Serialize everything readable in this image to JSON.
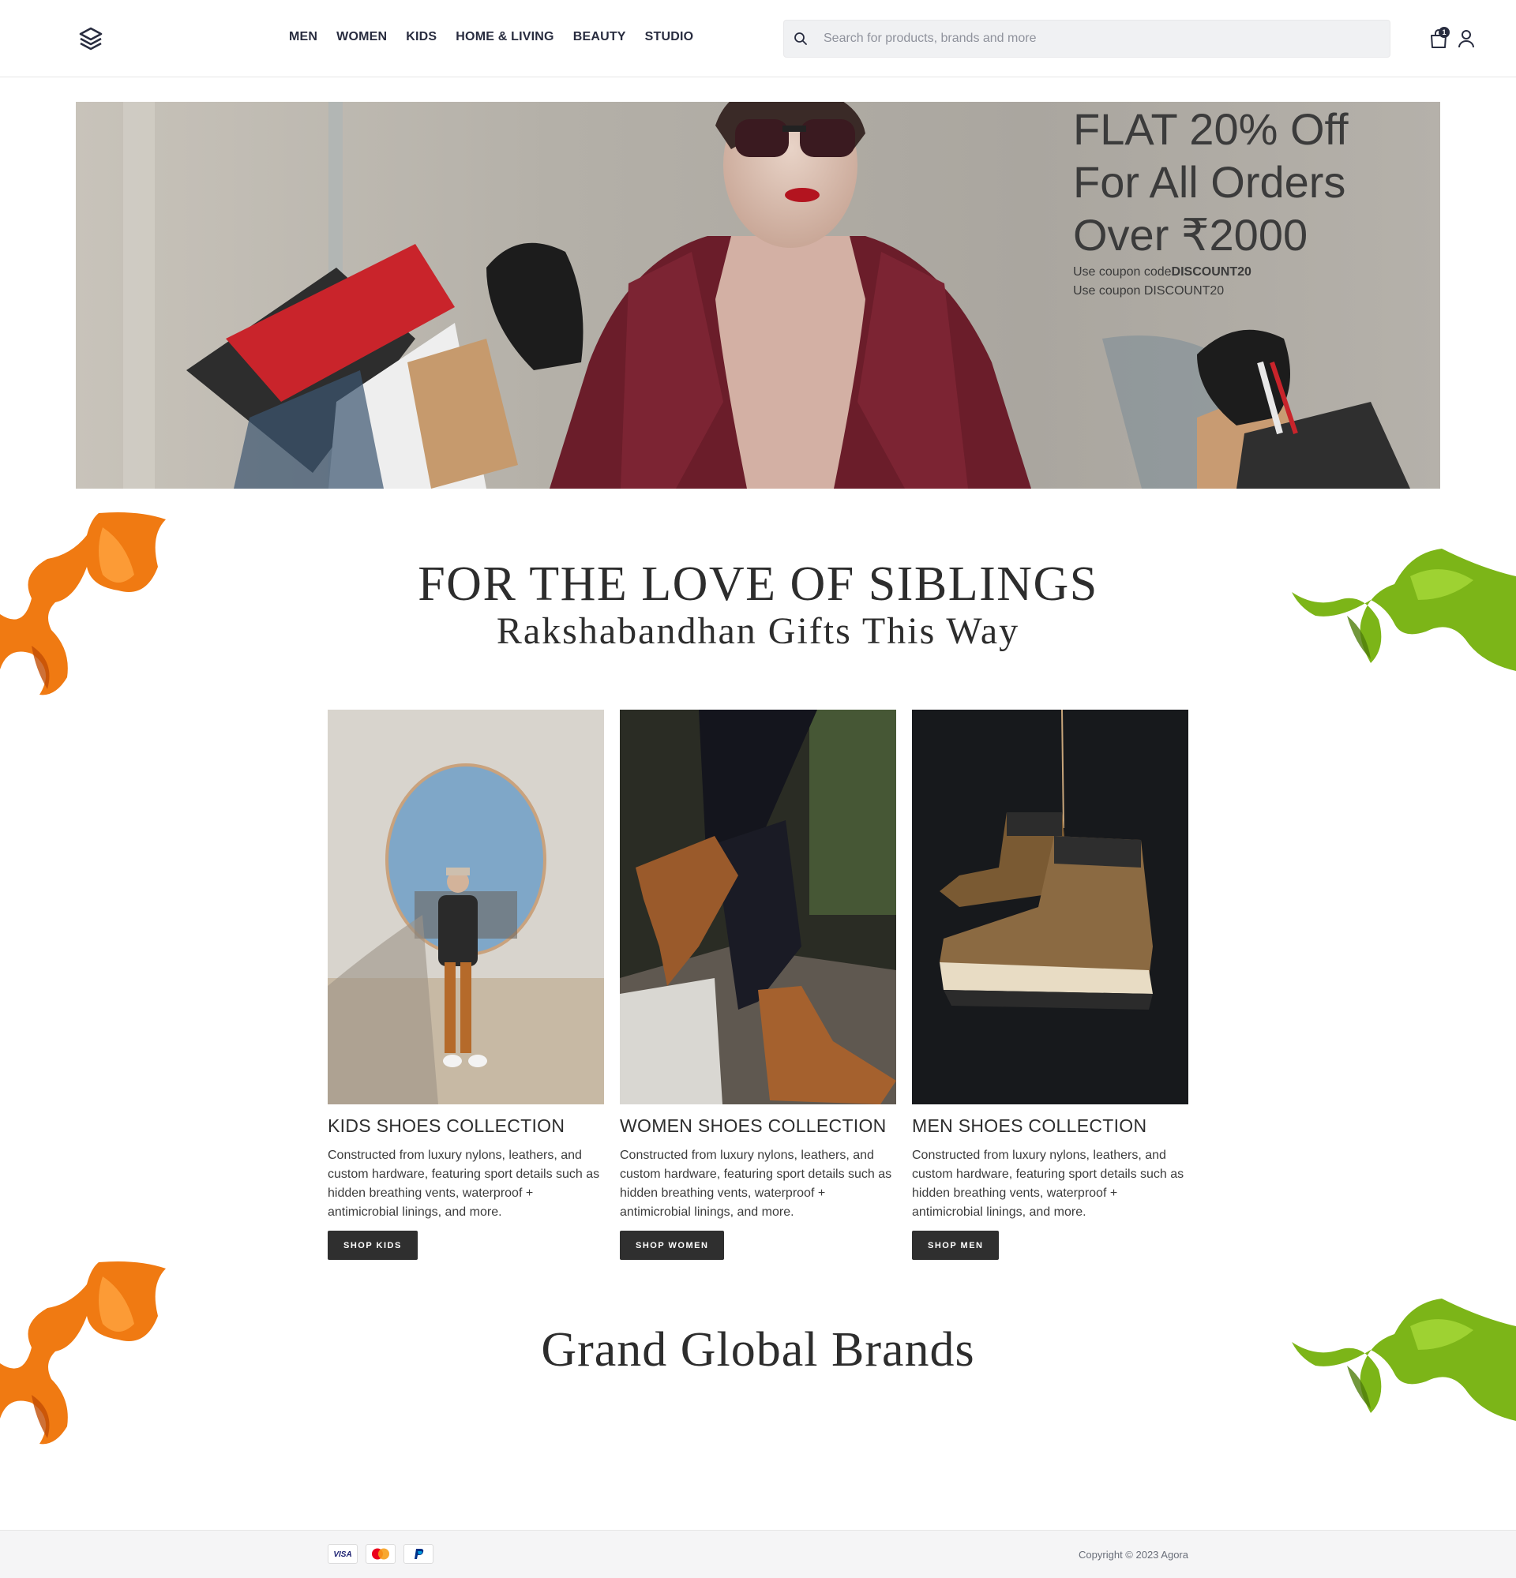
{
  "header": {
    "nav": [
      "MEN",
      "WOMEN",
      "KIDS",
      "HOME & LIVING",
      "BEAUTY",
      "STUDIO"
    ],
    "search_placeholder": "Search for products, brands and more",
    "bag_count": "1",
    "icons": [
      "logo-icon",
      "search-icon",
      "bag-icon",
      "user-icon"
    ]
  },
  "hero": {
    "title_line1": "FLAT 20% Off",
    "title_line2": "For All Orders",
    "title_line3": "Over ₹2000",
    "coupon_prefix": "Use coupon code",
    "coupon_code": "DISCOUNT20",
    "coupon_line2": "Use coupon DISCOUNT20"
  },
  "siblings": {
    "title": "FOR THE LOVE OF SIBLINGS",
    "subtitle": "Rakshabandhan Gifts This Way"
  },
  "collections": [
    {
      "title": "KIDS SHOES COLLECTION",
      "description": "Constructed from luxury nylons, leathers, and custom hardware, featuring sport details such as hidden breathing vents, waterproof + antimicrobial linings, and more.",
      "button": "SHOP KIDS"
    },
    {
      "title": "WOMEN SHOES COLLECTION",
      "description": "Constructed from luxury nylons, leathers, and custom hardware, featuring sport details such as hidden breathing vents, waterproof + antimicrobial linings, and more.",
      "button": "SHOP WOMEN"
    },
    {
      "title": "MEN SHOES COLLECTION",
      "description": "Constructed from luxury nylons, leathers, and custom hardware, featuring sport details such as hidden breathing vents, waterproof + antimicrobial linings, and more.",
      "button": "SHOP MEN"
    }
  ],
  "brands": {
    "title": "Grand Global Brands"
  },
  "footer": {
    "payment_methods": [
      "VISA",
      "Mastercard",
      "PayPal"
    ],
    "copyright": "Copyright © 2023 Agora"
  },
  "colors": {
    "text": "#282c3f",
    "button_bg": "#2f2f2f",
    "orange_ribbon": "#f07a12",
    "green_ribbon": "#7cb518"
  }
}
